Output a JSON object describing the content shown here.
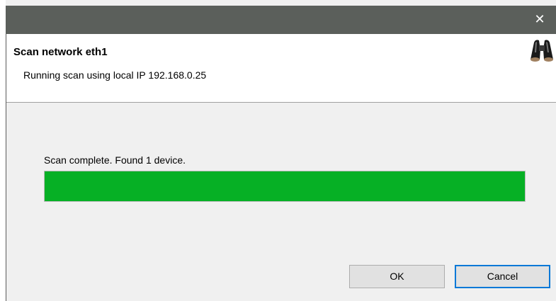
{
  "window": {
    "close_glyph": "✕"
  },
  "header": {
    "title": "Scan network eth1",
    "subtitle": "Running scan using local IP 192.168.0.25",
    "icon": "binoculars-icon"
  },
  "scan": {
    "status": "Scan complete. Found 1 device.",
    "progress_percent": 100,
    "progress_color": "#06b025"
  },
  "buttons": {
    "ok_label": "OK",
    "cancel_label": "Cancel"
  }
}
